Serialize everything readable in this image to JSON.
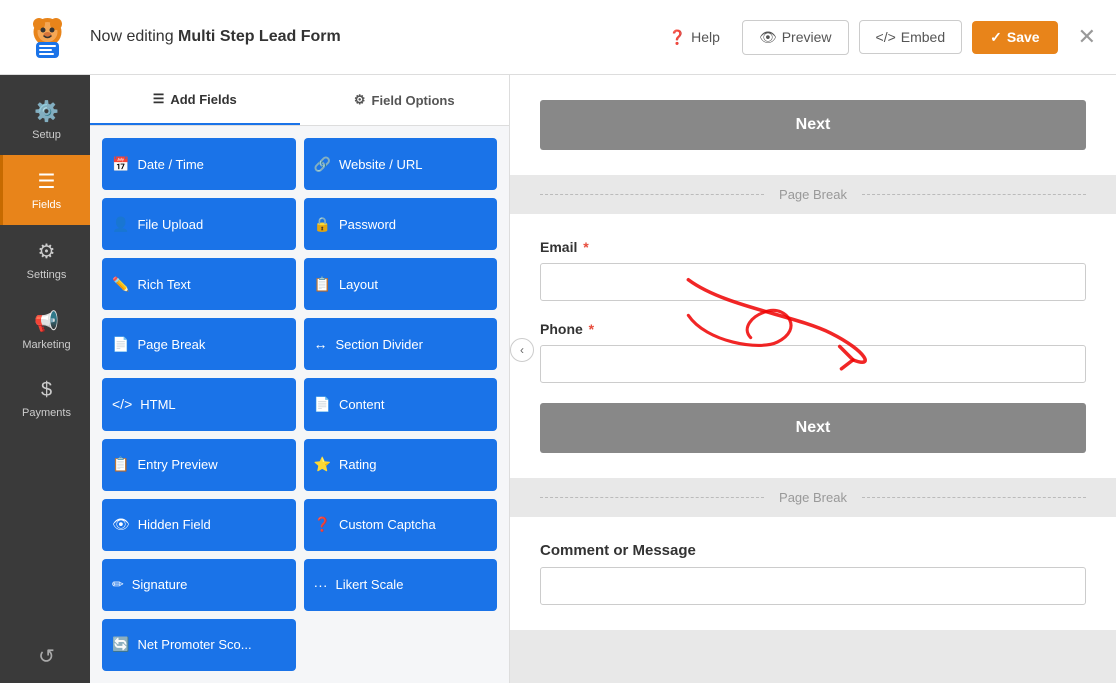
{
  "header": {
    "title_prefix": "Now editing ",
    "title_bold": "Multi Step Lead Form",
    "help_label": "Help",
    "preview_label": "Preview",
    "embed_label": "Embed",
    "save_label": "Save"
  },
  "sidebar_nav": {
    "items": [
      {
        "id": "setup",
        "label": "Setup",
        "icon": "⚙️"
      },
      {
        "id": "fields",
        "label": "Fields",
        "icon": "☰",
        "active": true
      },
      {
        "id": "settings",
        "label": "Settings",
        "icon": "⚙"
      },
      {
        "id": "marketing",
        "label": "Marketing",
        "icon": "📢"
      },
      {
        "id": "payments",
        "label": "Payments",
        "icon": "$"
      }
    ],
    "bottom_items": [
      {
        "id": "history",
        "label": "",
        "icon": "↺"
      }
    ]
  },
  "fields_panel": {
    "tabs": [
      {
        "id": "add_fields",
        "label": "Add Fields",
        "icon": "☰",
        "active": true
      },
      {
        "id": "field_options",
        "label": "Field Options",
        "icon": "⚙"
      }
    ],
    "field_buttons": [
      {
        "id": "date_time",
        "label": "Date / Time",
        "icon": "📅"
      },
      {
        "id": "website_url",
        "label": "Website / URL",
        "icon": "🔗"
      },
      {
        "id": "file_upload",
        "label": "File Upload",
        "icon": "👤"
      },
      {
        "id": "password",
        "label": "Password",
        "icon": "🔒"
      },
      {
        "id": "rich_text",
        "label": "Rich Text",
        "icon": "✏️"
      },
      {
        "id": "layout",
        "label": "Layout",
        "icon": "📋"
      },
      {
        "id": "page_break",
        "label": "Page Break",
        "icon": "📄"
      },
      {
        "id": "section_divider",
        "label": "Section Divider",
        "icon": "↔"
      },
      {
        "id": "html",
        "label": "HTML",
        "icon": "<>"
      },
      {
        "id": "content",
        "label": "Content",
        "icon": "📄"
      },
      {
        "id": "entry_preview",
        "label": "Entry Preview",
        "icon": "📋"
      },
      {
        "id": "rating",
        "label": "Rating",
        "icon": "⭐"
      },
      {
        "id": "hidden_field",
        "label": "Hidden Field",
        "icon": "👁"
      },
      {
        "id": "custom_captcha",
        "label": "Custom Captcha",
        "icon": "❓"
      },
      {
        "id": "signature",
        "label": "Signature",
        "icon": "✏"
      },
      {
        "id": "likert_scale",
        "label": "Likert Scale",
        "icon": "···"
      },
      {
        "id": "net_promoter",
        "label": "Net Promoter Sco...",
        "icon": "🔄"
      }
    ]
  },
  "form_preview": {
    "next_button_label": "Next",
    "page_break_label": "Page Break",
    "email_label": "Email",
    "email_required": true,
    "phone_label": "Phone",
    "phone_required": true,
    "next_button2_label": "Next",
    "page_break2_label": "Page Break",
    "comment_label": "Comment or Message"
  }
}
